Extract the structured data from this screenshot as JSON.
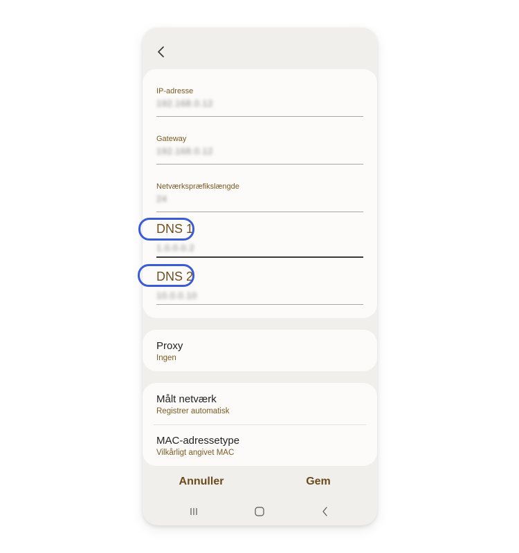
{
  "fields": [
    {
      "label": "IP-adresse",
      "value": "192.168.0.12"
    },
    {
      "label": "Gateway",
      "value": "192.168.0.12"
    },
    {
      "label": "Netværkspræfikslængde",
      "value": "24"
    },
    {
      "label": "DNS 1",
      "value": "1.0.0.0.2"
    },
    {
      "label": "DNS 2",
      "value": "10.0.0.10"
    }
  ],
  "proxy": {
    "title": "Proxy",
    "value": "Ingen"
  },
  "metered": {
    "title": "Målt netværk",
    "value": "Registrer automatisk"
  },
  "mac": {
    "title": "MAC-adressetype",
    "value": "Vilkårligt angivet MAC"
  },
  "actions": {
    "cancel": "Annuller",
    "save": "Gem"
  },
  "icons": {
    "back": "chevron-left-icon",
    "nav_recent": "recent-apps-icon",
    "nav_home": "home-icon",
    "nav_back": "back-icon"
  },
  "colors": {
    "accent_text": "#7a5a22",
    "highlight": "#3a5bd9",
    "background": "#f1efec",
    "card": "#fcfbf9"
  }
}
